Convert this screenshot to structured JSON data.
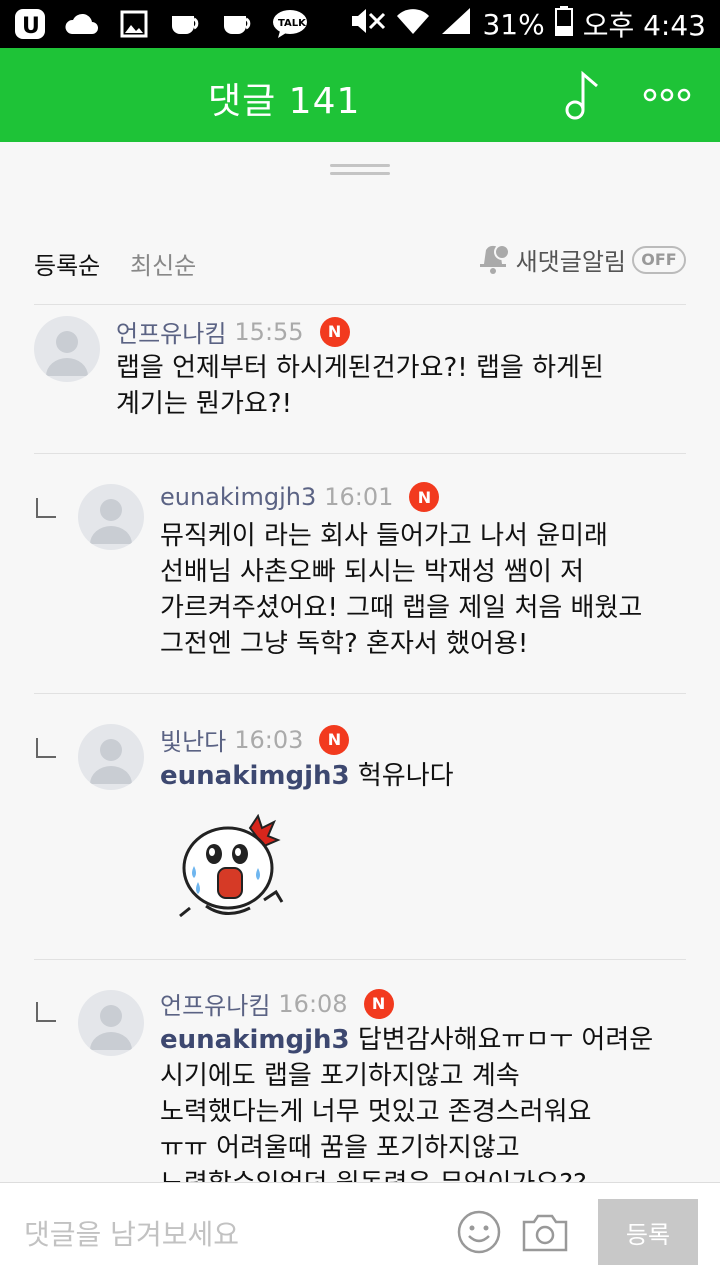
{
  "status_bar": {
    "battery": "31%",
    "time": "오후 4:43",
    "icons": [
      "u-plus-icon",
      "cloud-icon",
      "gallery-icon",
      "cup-icon",
      "cup-icon",
      "talk-icon",
      "mute-icon",
      "wifi-icon",
      "signal-icon",
      "battery-icon"
    ]
  },
  "header": {
    "title": "댓글 141",
    "icons": [
      "music-note-icon",
      "more-icon"
    ]
  },
  "sort": {
    "by_registered": "등록순",
    "by_latest": "최신순",
    "notify_label": "새댓글알림",
    "notify_state": "OFF"
  },
  "comments": [
    {
      "author": "언프유나킴",
      "time": "15:55",
      "badge": "N",
      "lines": [
        "랩을 언제부터 하시게된건가요?! 랩을 하게된",
        "계기는 뭔가요?!"
      ]
    },
    {
      "author": "eunakimgjh3",
      "time": "16:01",
      "badge": "N",
      "lines": [
        "뮤직케이 라는 회사 들어가고 나서 윤미래",
        "선배님 사촌오빠 되시는 박재성 쌤이 저",
        "가르켜주셨어요! 그때 랩을 제일 처음 배웠고",
        "그전엔 그냥 독학? 혼자서 했어용!"
      ]
    },
    {
      "author": "빛난다",
      "time": "16:03",
      "badge": "N",
      "mention": "eunakimgjh3",
      "text": " 헉유나다"
    },
    {
      "author": "언프유나킴",
      "time": "16:08",
      "badge": "N",
      "mention": "eunakimgjh3",
      "first_line_rest": " 답변감사해요ㅠㅁㅜ 어려운",
      "lines": [
        "시기에도 랩을 포기하지않고 계속",
        "노력했다는게 너무 멋있고 존경스러워요",
        "ㅠㅠ 어려울때 꿈을 포기하지않고",
        "노력할수있었던 원동력은 무엇이가요??"
      ]
    }
  ],
  "input": {
    "placeholder": "댓글을 남겨보세요",
    "submit_label": "등록"
  }
}
